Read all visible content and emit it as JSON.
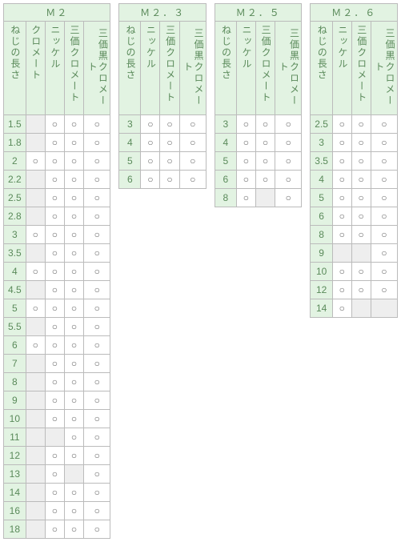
{
  "mark": "○",
  "headers": {
    "length": "ねじの長さ",
    "opt1": "クロメート",
    "opt2": "ニッケル",
    "opt3": "三価クロメート",
    "opt4": "三価黒クロメート"
  },
  "tables": [
    {
      "title": "Ｍ２",
      "columns": [
        "length",
        "opt1",
        "opt2",
        "opt3",
        "opt4"
      ],
      "rows": [
        {
          "len": "1.5",
          "v": [
            "s",
            "o",
            "o",
            "o"
          ]
        },
        {
          "len": "1.8",
          "v": [
            "s",
            "o",
            "o",
            "o"
          ]
        },
        {
          "len": "2",
          "v": [
            "o",
            "o",
            "o",
            "o"
          ]
        },
        {
          "len": "2.2",
          "v": [
            "s",
            "o",
            "o",
            "o"
          ]
        },
        {
          "len": "2.5",
          "v": [
            "s",
            "o",
            "o",
            "o"
          ]
        },
        {
          "len": "2.8",
          "v": [
            "s",
            "o",
            "o",
            "o"
          ]
        },
        {
          "len": "3",
          "v": [
            "o",
            "o",
            "o",
            "o"
          ]
        },
        {
          "len": "3.5",
          "v": [
            "s",
            "o",
            "o",
            "o"
          ]
        },
        {
          "len": "4",
          "v": [
            "o",
            "o",
            "o",
            "o"
          ]
        },
        {
          "len": "4.5",
          "v": [
            "s",
            "o",
            "o",
            "o"
          ]
        },
        {
          "len": "5",
          "v": [
            "o",
            "o",
            "o",
            "o"
          ]
        },
        {
          "len": "5.5",
          "v": [
            "s",
            "o",
            "o",
            "o"
          ]
        },
        {
          "len": "6",
          "v": [
            "o",
            "o",
            "o",
            "o"
          ]
        },
        {
          "len": "7",
          "v": [
            "s",
            "o",
            "o",
            "o"
          ]
        },
        {
          "len": "8",
          "v": [
            "s",
            "o",
            "o",
            "o"
          ]
        },
        {
          "len": "9",
          "v": [
            "s",
            "o",
            "o",
            "o"
          ]
        },
        {
          "len": "10",
          "v": [
            "s",
            "o",
            "o",
            "o"
          ]
        },
        {
          "len": "11",
          "v": [
            "s",
            "s",
            "o",
            "o"
          ]
        },
        {
          "len": "12",
          "v": [
            "s",
            "o",
            "o",
            "o"
          ]
        },
        {
          "len": "13",
          "v": [
            "s",
            "o",
            "s",
            "o"
          ]
        },
        {
          "len": "14",
          "v": [
            "s",
            "o",
            "o",
            "o"
          ]
        },
        {
          "len": "16",
          "v": [
            "s",
            "o",
            "o",
            "o"
          ]
        },
        {
          "len": "18",
          "v": [
            "s",
            "o",
            "o",
            "o"
          ]
        }
      ]
    },
    {
      "title": "Ｍ２．３",
      "columns": [
        "length",
        "opt2",
        "opt3",
        "opt4"
      ],
      "rows": [
        {
          "len": "3",
          "v": [
            "o",
            "o",
            "o"
          ]
        },
        {
          "len": "4",
          "v": [
            "o",
            "o",
            "o"
          ]
        },
        {
          "len": "5",
          "v": [
            "o",
            "o",
            "o"
          ]
        },
        {
          "len": "6",
          "v": [
            "o",
            "o",
            "o"
          ]
        }
      ]
    },
    {
      "title": "Ｍ２．５",
      "columns": [
        "length",
        "opt2",
        "opt3",
        "opt4"
      ],
      "rows": [
        {
          "len": "3",
          "v": [
            "o",
            "o",
            "o"
          ]
        },
        {
          "len": "4",
          "v": [
            "o",
            "o",
            "o"
          ]
        },
        {
          "len": "5",
          "v": [
            "o",
            "o",
            "o"
          ]
        },
        {
          "len": "6",
          "v": [
            "o",
            "o",
            "o"
          ]
        },
        {
          "len": "8",
          "v": [
            "o",
            "s",
            "o"
          ]
        }
      ]
    },
    {
      "title": "Ｍ２．６",
      "columns": [
        "length",
        "opt2",
        "opt3",
        "opt4"
      ],
      "rows": [
        {
          "len": "2.5",
          "v": [
            "o",
            "o",
            "o"
          ]
        },
        {
          "len": "3",
          "v": [
            "o",
            "o",
            "o"
          ]
        },
        {
          "len": "3.5",
          "v": [
            "o",
            "o",
            "o"
          ]
        },
        {
          "len": "4",
          "v": [
            "o",
            "o",
            "o"
          ]
        },
        {
          "len": "5",
          "v": [
            "o",
            "o",
            "o"
          ]
        },
        {
          "len": "6",
          "v": [
            "o",
            "o",
            "o"
          ]
        },
        {
          "len": "8",
          "v": [
            "o",
            "o",
            "o"
          ]
        },
        {
          "len": "9",
          "v": [
            "s",
            "s",
            "o"
          ]
        },
        {
          "len": "10",
          "v": [
            "o",
            "o",
            "o"
          ]
        },
        {
          "len": "12",
          "v": [
            "o",
            "o",
            "o"
          ]
        },
        {
          "len": "14",
          "v": [
            "o",
            "s",
            "s"
          ]
        }
      ]
    }
  ]
}
